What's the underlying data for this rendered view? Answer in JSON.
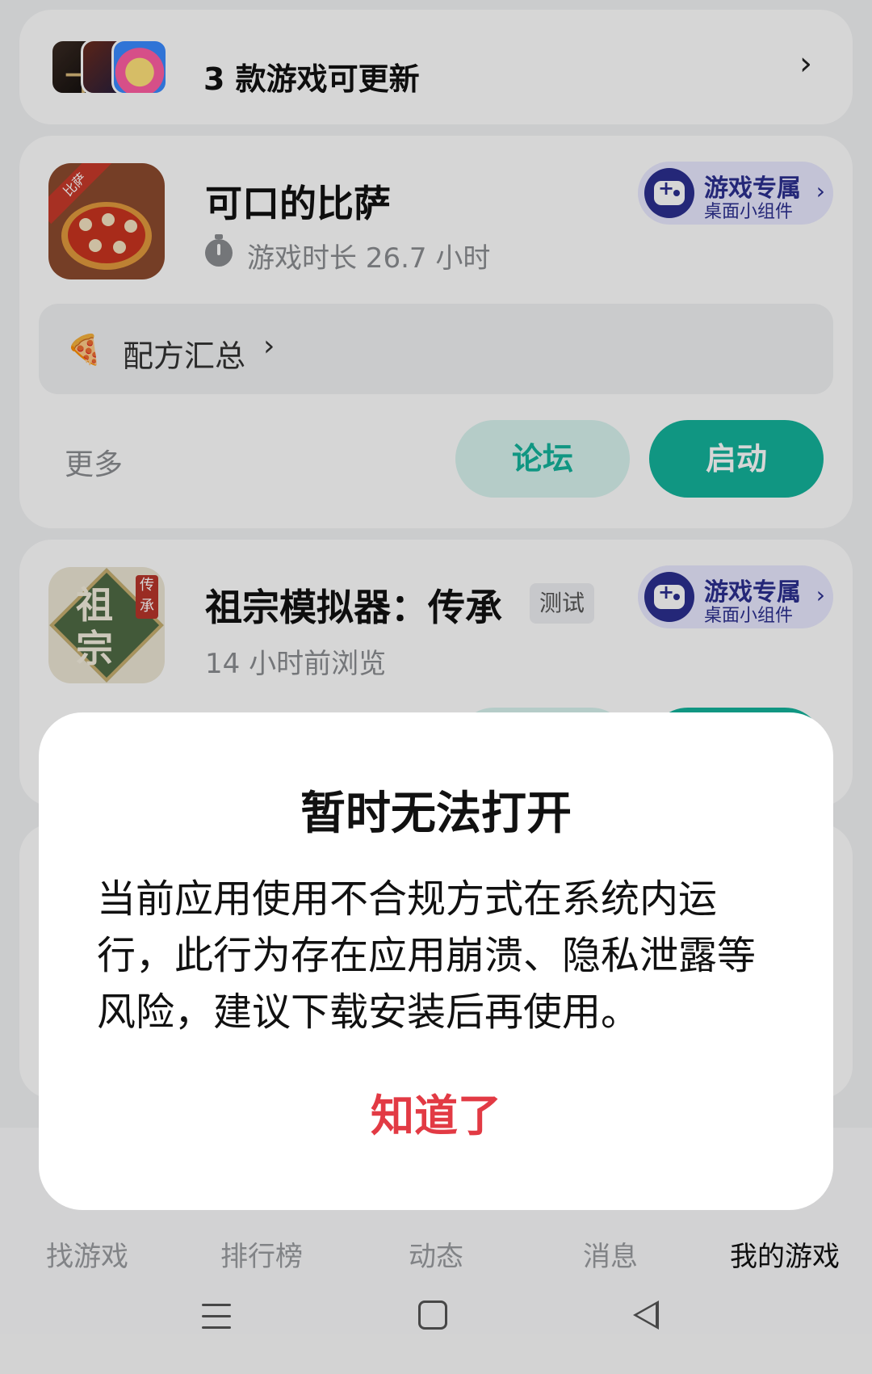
{
  "update_banner": {
    "text": "3 款游戏可更新"
  },
  "games": [
    {
      "title": "可口的比萨",
      "stat": "游戏时长 26.7 小时",
      "icon_ribbon": "比萨",
      "widget_title": "游戏专属",
      "widget_subtitle": "桌面小组件",
      "recipe_label": "配方汇总",
      "more_label": "更多",
      "forum_label": "论坛",
      "launch_label": "启动"
    },
    {
      "title": "祖宗模拟器：传承",
      "badge": "测试",
      "stat": "14 小时前浏览",
      "icon_text": "祖宗",
      "icon_tag": "传承",
      "widget_title": "游戏专属",
      "widget_subtitle": "桌面小组件"
    }
  ],
  "bottom_nav": {
    "items": [
      "找游戏",
      "排行榜",
      "动态",
      "消息",
      "我的游戏"
    ],
    "active_index": 4
  },
  "dialog": {
    "title": "暂时无法打开",
    "body": "当前应用使用不合规方式在系统内运行，此行为存在应用崩溃、隐私泄露等风险，建议下载安装后再使用。",
    "ok_label": "知道了"
  },
  "colors": {
    "accent": "#14b39b",
    "widget": "#2b2f8f",
    "danger": "#e23a44"
  },
  "icons": [
    "chevron-right-icon",
    "stopwatch-icon",
    "pizza-slice-icon",
    "gamepad-icon",
    "menu-icon",
    "home-icon",
    "back-icon"
  ]
}
